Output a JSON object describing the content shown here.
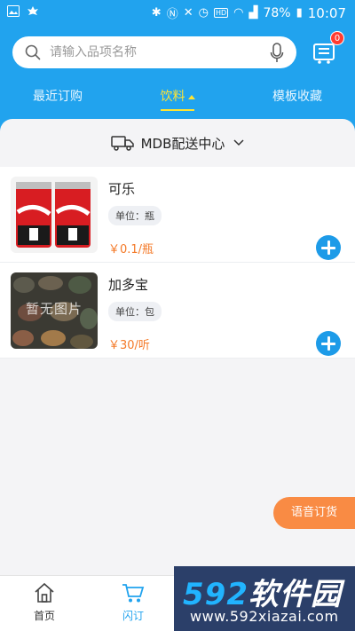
{
  "status_bar": {
    "battery": "78%",
    "time": "10:07"
  },
  "search": {
    "placeholder": "请输入品项名称"
  },
  "cart": {
    "badge_count": "0"
  },
  "tabs": [
    {
      "label": "最近订购",
      "active": false
    },
    {
      "label": "饮料",
      "active": true
    },
    {
      "label": "模板收藏",
      "active": false
    }
  ],
  "distribution": {
    "label": "MDB配送中心"
  },
  "products": [
    {
      "name": "可乐",
      "unit": "单位：瓶",
      "price": "￥0.1/瓶",
      "image": "cola-can-photo"
    },
    {
      "name": "加多宝",
      "unit": "单位：包",
      "price": "￥30/听",
      "image": "no-image-placeholder",
      "image_text": "暂无图片"
    }
  ],
  "voice_order": {
    "label": "语音订货"
  },
  "bottom_nav": [
    {
      "label": "首页",
      "icon": "home-icon",
      "active": false
    },
    {
      "label": "闪订",
      "icon": "cart-icon",
      "active": true
    }
  ],
  "watermark": {
    "title_num": "592",
    "title_text": "软件园",
    "url": "www.592xiazai.com"
  },
  "colors": {
    "primary": "#21a3ee",
    "accent": "#ffe433",
    "price": "#f47a29",
    "voice_button": "#f98b44"
  }
}
